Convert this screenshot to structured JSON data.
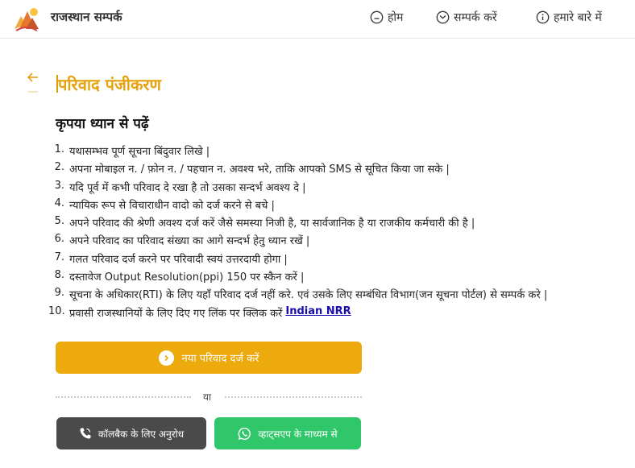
{
  "header": {
    "brand": "राजस्थान सम्पर्क",
    "nav": [
      {
        "label": "होम",
        "icon": "home-icon"
      },
      {
        "label": "सम्पर्क करें",
        "icon": "mail-icon"
      },
      {
        "label": "हमारे बारे में",
        "icon": "info-icon"
      }
    ]
  },
  "page": {
    "title": "परिवाद पंजीकरण",
    "subtitle": "कृपया ध्यान से पढ़ें"
  },
  "instructions": [
    {
      "num": "1.",
      "text": "यथासम्भव पूर्ण सूचना बिंदुवार लिखे |"
    },
    {
      "num": "2.",
      "text": "अपना मोबाइल न. / फ़ोन न. / पहचान न. अवश्य भरे, ताकि आपको SMS से सूचित किया जा सके |"
    },
    {
      "num": "3.",
      "text": "यदि पूर्व में कभी परिवाद दे रखा है तो उसका सन्दर्भ अवश्य दे |"
    },
    {
      "num": "4.",
      "text": "न्यायिक रूप से विचाराधीन वादो को दर्ज करने से बचे |"
    },
    {
      "num": "5.",
      "text": "अपने परिवाद की श्रेणी अवश्य दर्ज करें जैसे समस्या निजी है, या सार्वजानिक है या राजकीय कर्मचारी की है |"
    },
    {
      "num": "6.",
      "text": "अपने परिवाद का परिवाद संख्या का आगे सन्दर्भ हेतु ध्यान रखें |"
    },
    {
      "num": "7.",
      "text": "गलत परिवाद दर्ज करने पर परिवादी स्वयं उत्तरदायी होगा |"
    },
    {
      "num": "8.",
      "text": "दस्तावेज Output Resolution(ppi) 150 पर स्कैन करें |"
    },
    {
      "num": "9.",
      "text": "सूचना के अधिकार(RTI) के लिए यहाँ परिवाद दर्ज नहीं करे. एवं उसके लिए सम्बंधित विभाग(जन सूचना पोर्टल) से सम्पर्क करे |"
    },
    {
      "num": "10.",
      "text": "प्रवासी राजस्थानियों के लिए दिए गए लिंक पर क्लिक करें",
      "link": "Indian NRR"
    }
  ],
  "actions": {
    "new_complaint": "नया परिवाद दर्ज करें",
    "or": "या",
    "callback": "कॉलबैक के लिए अनुरोध",
    "whatsapp": "व्हाट्सएप के माध्यम से"
  },
  "colors": {
    "accent": "#ecaa0c",
    "title": "#e4a20c",
    "callback_bg": "#4a4a4a",
    "whatsapp_bg": "#2fc76a",
    "link": "#1a0dab"
  }
}
